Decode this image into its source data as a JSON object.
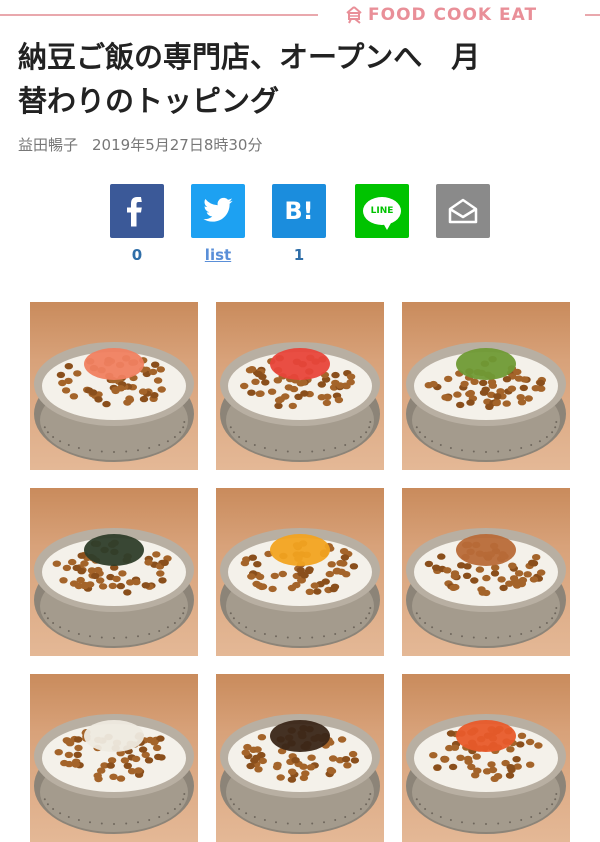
{
  "header": {
    "brand_text": "FOOD COOK EAT",
    "brand_icon": "food-kanji-icon",
    "accent_color": "#e98f98"
  },
  "article": {
    "title": "納豆ご飯の専門店、オープンへ　月\n替わりのトッピング",
    "author": "益田暢子",
    "date": "2019年5月27日8時30分"
  },
  "share": [
    {
      "name": "facebook",
      "icon": "facebook-icon",
      "color": "#3b5998",
      "count": "0"
    },
    {
      "name": "twitter",
      "icon": "twitter-icon",
      "color": "#1da1f2",
      "count": "list"
    },
    {
      "name": "hatena",
      "icon": "hatena-bookmark-icon",
      "color": "#1b8ddd",
      "glyph": "B!",
      "count": "1"
    },
    {
      "name": "line",
      "icon": "line-icon",
      "color": "#00c300",
      "glyph": "LINE",
      "count": ""
    },
    {
      "name": "mail",
      "icon": "mail-icon",
      "color": "#8a8a8a",
      "count": ""
    }
  ],
  "gallery": [
    {
      "topping": "mentaiko",
      "color": "#f08060"
    },
    {
      "topping": "red-ginger",
      "color": "#e8453a"
    },
    {
      "topping": "wasabi",
      "color": "#6f9a35"
    },
    {
      "topping": "nori",
      "color": "#2e3d2a"
    },
    {
      "topping": "egg-yolk",
      "color": "#f2a320"
    },
    {
      "topping": "crispy-flakes",
      "color": "#b86a38"
    },
    {
      "topping": "shirasu",
      "color": "#eeeae0"
    },
    {
      "topping": "shiitake",
      "color": "#3a2618"
    },
    {
      "topping": "kimchi",
      "color": "#e85a2a"
    }
  ]
}
